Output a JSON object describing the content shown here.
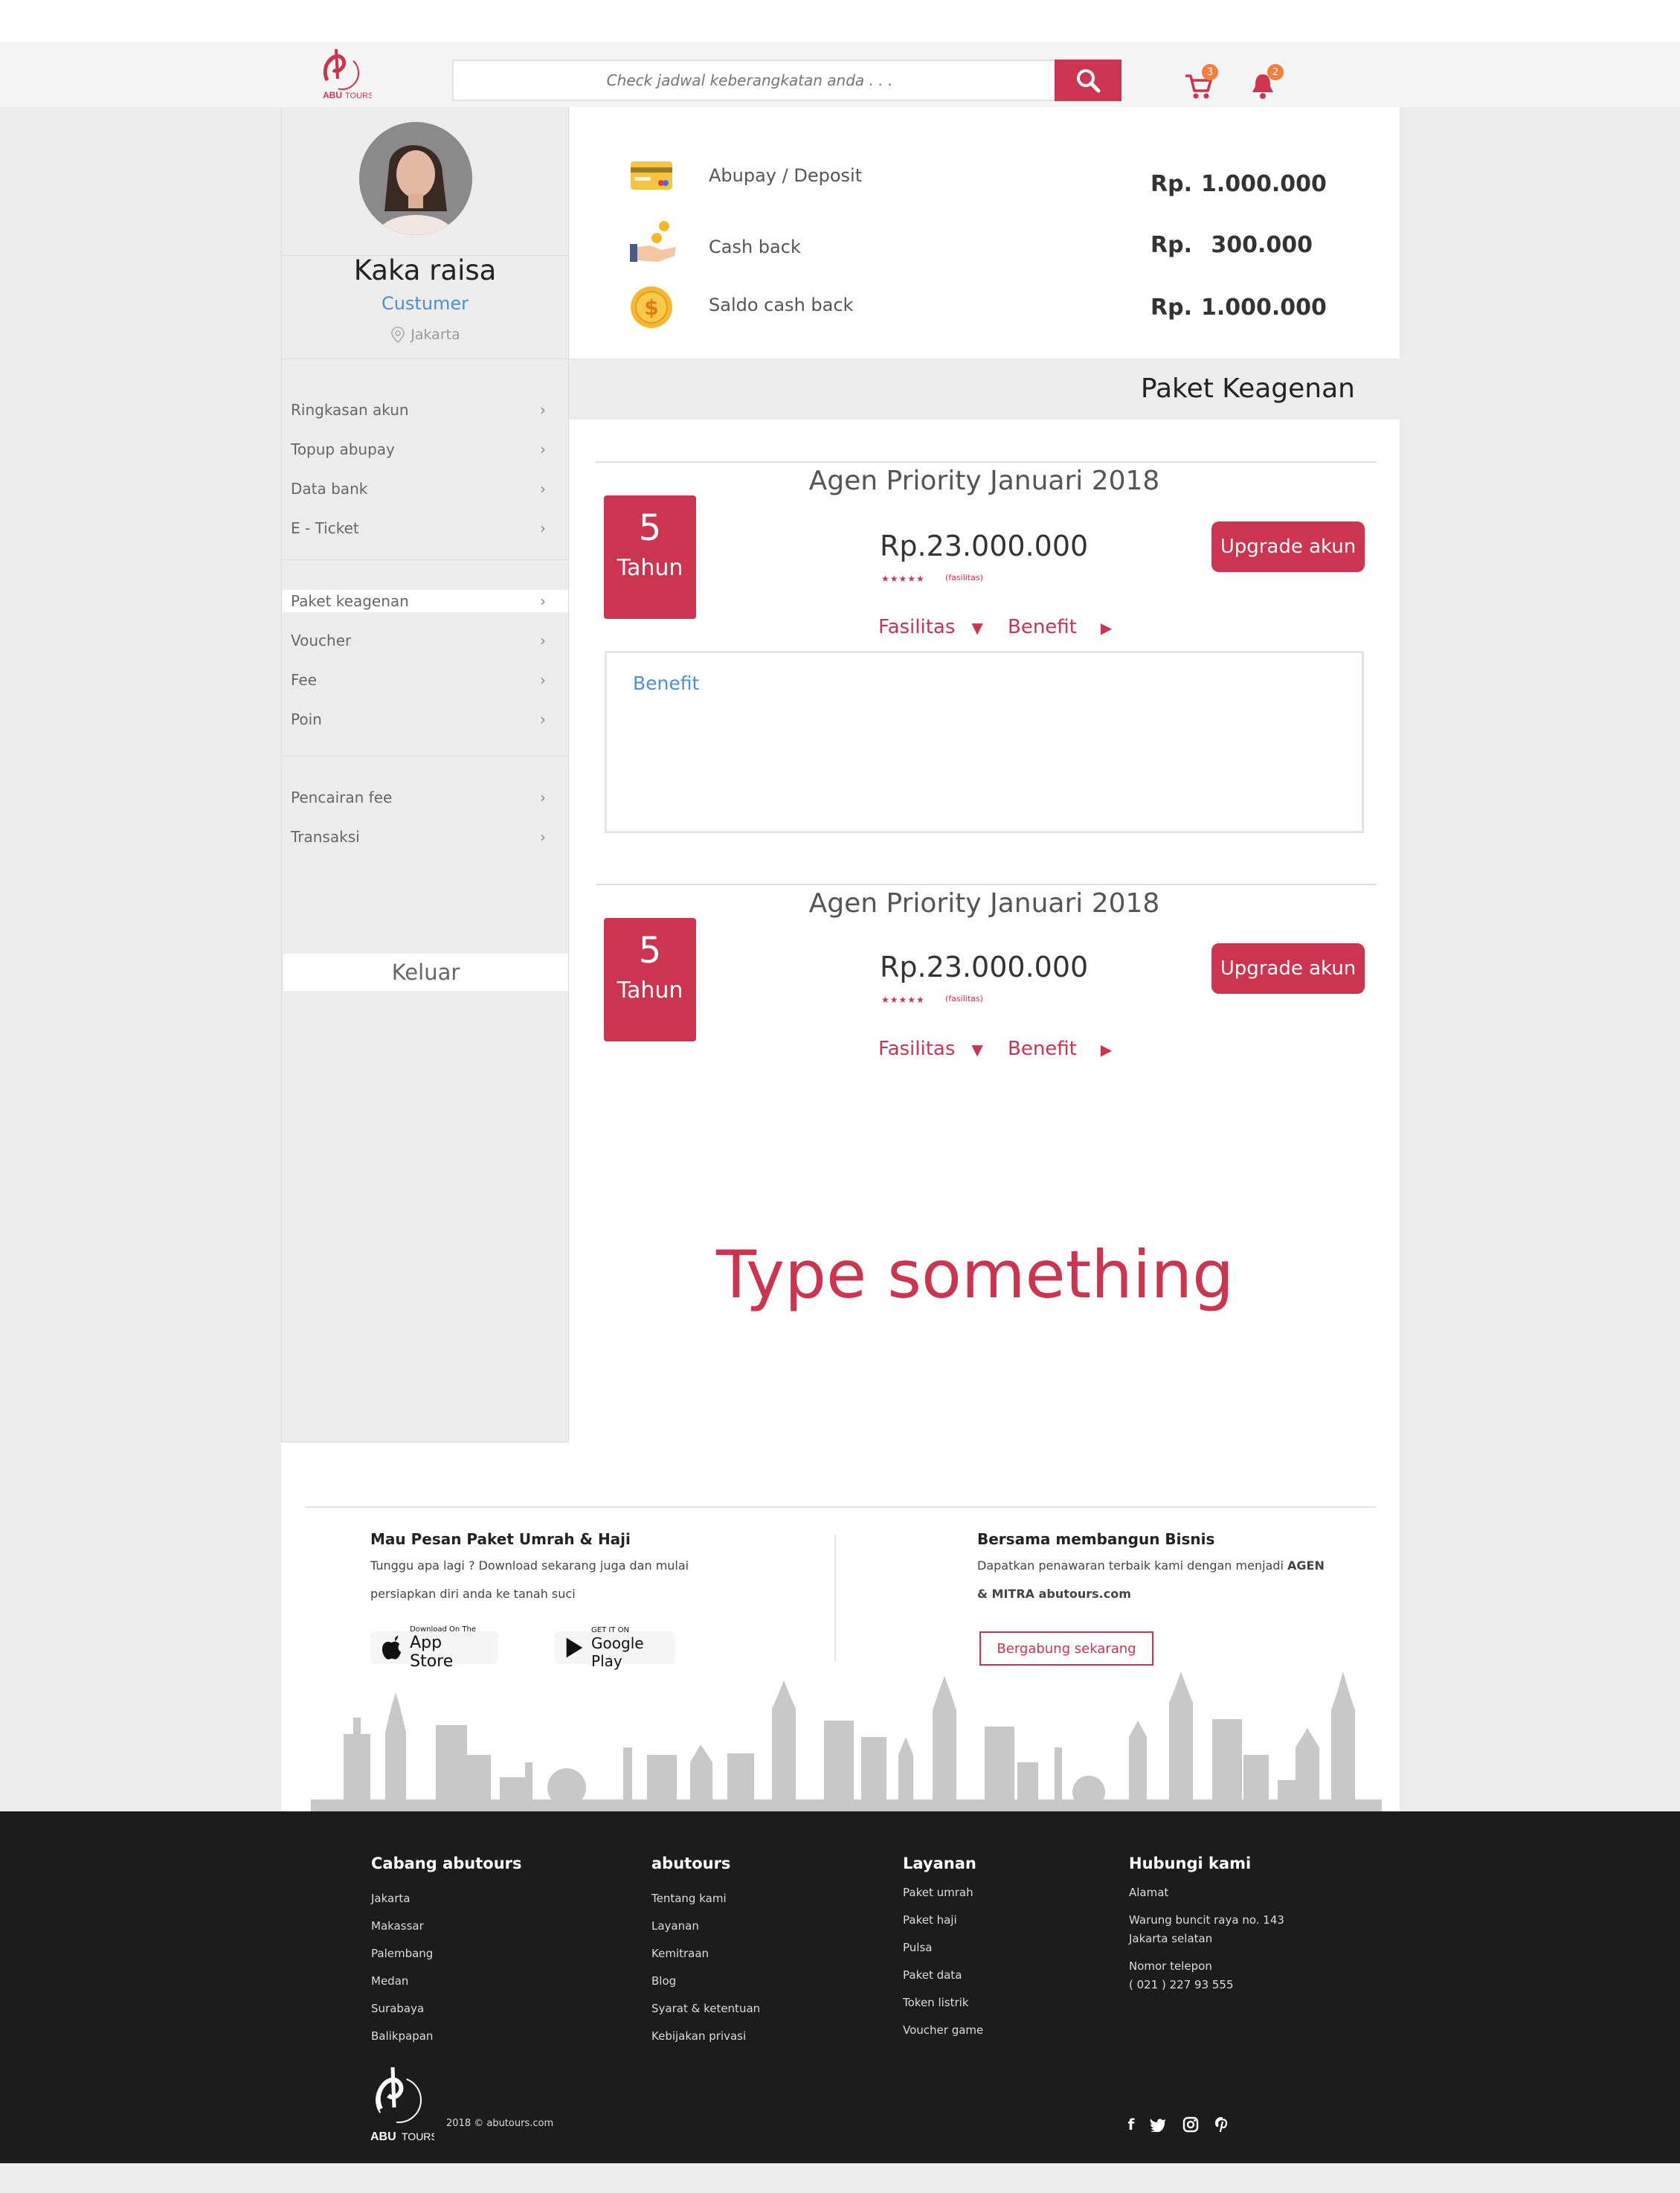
{
  "header": {
    "search_placeholder": "Check jadwal keberangkatan anda . . .",
    "cart_count": "3",
    "notif_count": "2",
    "brand_color": "#cc3450"
  },
  "profile": {
    "name": "Kaka raisa",
    "role": "Custumer",
    "location": "Jakarta"
  },
  "sidebar": {
    "group1": [
      "Ringkasan akun",
      "Topup abupay",
      "Data bank",
      "E - Ticket"
    ],
    "group2": [
      "Paket keagenan",
      "Voucher",
      "Fee",
      "Poin"
    ],
    "group3": [
      "Pencairan fee",
      "Transaksi"
    ],
    "active": "Paket keagenan",
    "logout": "Keluar"
  },
  "balances": [
    {
      "label": "Abupay / Deposit",
      "currency": "Rp.",
      "amount": "1.000.000",
      "icon": "card-icon"
    },
    {
      "label": "Cash back",
      "currency": "Rp.",
      "amount": "300.000",
      "icon": "coin-hand-icon"
    },
    {
      "label": "Saldo cash back",
      "currency": "Rp.",
      "amount": "1.000.000",
      "icon": "dollar-coin-icon"
    }
  ],
  "paket": {
    "title": "Paket Keagenan",
    "packages": [
      {
        "name": "Agen Priority Januari 2018",
        "years": "5",
        "years_label": "Tahun",
        "price": "Rp.23.000.000",
        "stars": "★★★★★",
        "fasilitas_small": "(fasilitas)",
        "upgrade": "Upgrade akun",
        "tab_fasilitas": "Fasilitas",
        "tab_benefit": "Benefit"
      },
      {
        "name": "Agen Priority Januari 2018",
        "years": "5",
        "years_label": "Tahun",
        "price": "Rp.23.000.000",
        "stars": "★★★★★",
        "fasilitas_small": "(fasilitas)",
        "upgrade": "Upgrade akun",
        "tab_fasilitas": "Fasilitas",
        "tab_benefit": "Benefit"
      }
    ],
    "benefit_title": "Benefit",
    "placeholder_text": "Type something"
  },
  "promo": {
    "left_title": "Mau Pesan Paket Umrah & Haji",
    "left_line1": "Tunggu apa lagi ? Download sekarang juga dan mulai",
    "left_line2": "persiapkan diri anda ke tanah suci",
    "appstore_small": "Download On The",
    "appstore_big": "App Store",
    "gplay_small": "GET IT ON",
    "gplay_big": "Google Play",
    "right_title": "Bersama membangun Bisnis",
    "right_line1": "Dapatkan penawaran terbaik kami dengan menjadi",
    "right_bold1": "AGEN",
    "right_bold2": "& MITRA abutours.com",
    "join_button": "Bergabung sekarang"
  },
  "footer": {
    "cabang_title": "Cabang abutours",
    "cabang": [
      "Jakarta",
      "Makassar",
      "Palembang",
      "Medan",
      "Surabaya",
      "Balikpapan"
    ],
    "abutours_title": "abutours",
    "abutours_links": [
      "Tentang kami",
      "Layanan",
      "Kemitraan",
      "Blog",
      "Syarat & ketentuan",
      "Kebijakan privasi"
    ],
    "layanan_title": "Layanan",
    "layanan": [
      "Paket umrah",
      "Paket haji",
      "Pulsa",
      "Paket data",
      "Token listrik",
      "Voucher game"
    ],
    "kontak_title": "Hubungi kami",
    "alamat_label": "Alamat",
    "alamat_line1": "Warung buncit raya no. 143",
    "alamat_line2": "Jakarta selatan",
    "telp_label": "Nomor telepon",
    "telp": "( 021 )  227 93 555",
    "copyright": "2018 © abutours.com",
    "brand_logo_text": "ABUTOURS",
    "social": [
      "facebook-icon",
      "twitter-icon",
      "instagram-icon",
      "pinterest-icon"
    ]
  }
}
